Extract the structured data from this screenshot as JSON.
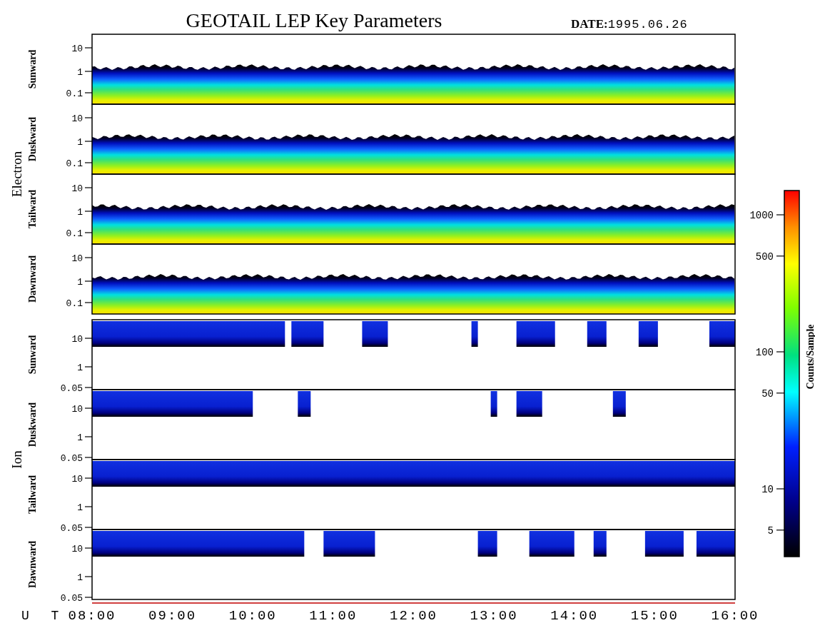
{
  "title": "GEOTAIL LEP Key Parameters",
  "date_label": "DATE:",
  "date": "1995.06.26",
  "groups": [
    {
      "label": "Electron",
      "kind": "electron",
      "panels": [
        {
          "label": "Sunward",
          "yticks": [
            "10",
            "1",
            "0.1"
          ]
        },
        {
          "label": "Duskward",
          "yticks": [
            "10",
            "1",
            "0.1"
          ]
        },
        {
          "label": "Tailward",
          "yticks": [
            "10",
            "1",
            "0.1"
          ]
        },
        {
          "label": "Dawnward",
          "yticks": [
            "10",
            "1",
            "0.1"
          ]
        }
      ]
    },
    {
      "label": "Ion",
      "kind": "ion",
      "panels": [
        {
          "label": "Sunward",
          "yticks": [
            "10",
            "1",
            "0.05"
          ]
        },
        {
          "label": "Duskward",
          "yticks": [
            "10",
            "1",
            "0.05"
          ]
        },
        {
          "label": "Tailward",
          "yticks": [
            "10",
            "1",
            "0.05"
          ]
        },
        {
          "label": "Dawnward",
          "yticks": [
            "10",
            "1",
            "0.05"
          ]
        }
      ]
    }
  ],
  "x_axis": {
    "label": "U T",
    "ticks": [
      "08:00",
      "09:00",
      "10:00",
      "11:00",
      "12:00",
      "13:00",
      "14:00",
      "15:00",
      "16:00"
    ]
  },
  "colorbar": {
    "label": "Counts/Sample",
    "ticks": [
      "1000",
      "500",
      "100",
      "50",
      "10",
      "5"
    ]
  }
}
